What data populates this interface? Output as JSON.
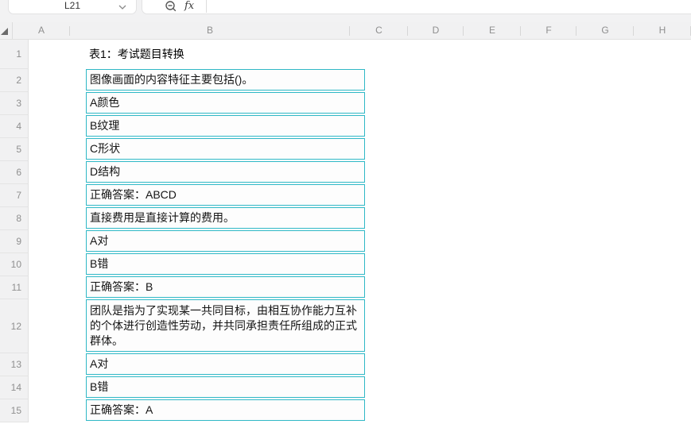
{
  "toolbar": {
    "cell_reference": "L21",
    "fx_label": "fx",
    "icons": {
      "name_box_dropdown": "chevron-down-icon",
      "formula_zoom": "zoom-out-icon",
      "function": "fx-icon"
    }
  },
  "grid": {
    "column_headers": [
      "A",
      "B",
      "C",
      "D",
      "E",
      "F",
      "G",
      "H"
    ],
    "row_numbers": [
      "1",
      "2",
      "3",
      "4",
      "5",
      "6",
      "7",
      "8",
      "9",
      "10",
      "11",
      "12",
      "13",
      "14",
      "15"
    ]
  },
  "content": {
    "title": "表1：考试题目转换",
    "cells": [
      {
        "row": "2",
        "text": "图像画面的内容特征主要包括()。"
      },
      {
        "row": "3",
        "text": "A颜色"
      },
      {
        "row": "4",
        "text": "B纹理"
      },
      {
        "row": "5",
        "text": "C形状"
      },
      {
        "row": "6",
        "text": "D结构"
      },
      {
        "row": "7",
        "text": "正确答案：ABCD"
      },
      {
        "row": "8",
        "text": "直接费用是直接计算的费用。"
      },
      {
        "row": "9",
        "text": "A对"
      },
      {
        "row": "10",
        "text": "B错"
      },
      {
        "row": "11",
        "text": "正确答案：B"
      },
      {
        "row": "12",
        "text": "团队是指为了实现某一共同目标，由相互协作能力互补的个体进行创造性劳动，并共同承担责任所组成的正式群体。"
      },
      {
        "row": "13",
        "text": "A对"
      },
      {
        "row": "14",
        "text": "B错"
      },
      {
        "row": "15",
        "text": "正确答案：A"
      }
    ]
  },
  "colors": {
    "cell_border": "#2fb8c6",
    "header_bg": "#f1f1f2",
    "toolbar_bg": "#f2f2f3",
    "header_text": "#8f8f8f"
  }
}
